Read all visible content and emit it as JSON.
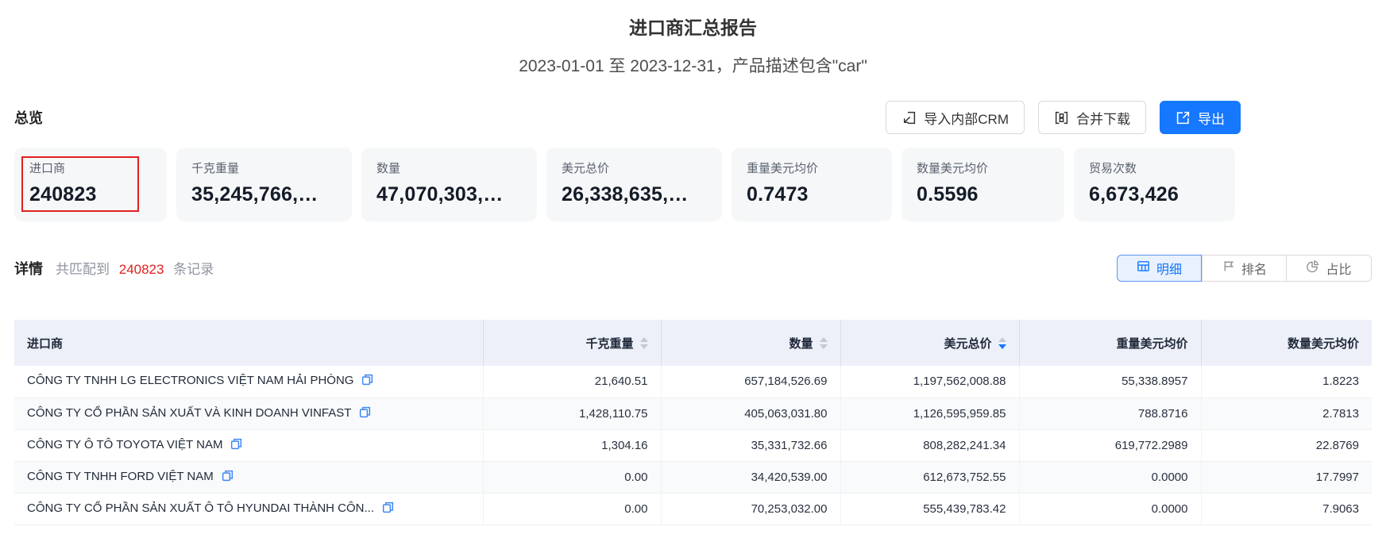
{
  "report": {
    "title": "进口商汇总报告",
    "subtitle": "2023-01-01 至 2023-12-31，产品描述包含\"car\""
  },
  "overview": {
    "section_title": "总览",
    "buttons": [
      {
        "label": "导入内部CRM",
        "icon": "import-icon"
      },
      {
        "label": "合并下载",
        "icon": "merge-download-icon"
      },
      {
        "label": "导出",
        "icon": "export-icon",
        "primary": true
      }
    ],
    "cards": [
      {
        "id": "importers",
        "label": "进口商",
        "value": "240823",
        "highlighted": true
      },
      {
        "id": "kg-weight",
        "label": "千克重量",
        "value": "35,245,766,…"
      },
      {
        "id": "quantity",
        "label": "数量",
        "value": "47,070,303,…"
      },
      {
        "id": "usd-total",
        "label": "美元总价",
        "value": "26,338,635,…"
      },
      {
        "id": "usd-per-kg",
        "label": "重量美元均价",
        "value": "0.7473"
      },
      {
        "id": "usd-per-qty",
        "label": "数量美元均价",
        "value": "0.5596"
      },
      {
        "id": "trade-count",
        "label": "贸易次数",
        "value": "6,673,426"
      }
    ]
  },
  "details": {
    "section_title": "详情",
    "match_prefix": "共匹配到",
    "match_count": "240823",
    "match_suffix": "条记录",
    "tabs": [
      {
        "id": "detail",
        "label": "明细",
        "icon": "table-icon",
        "active": true
      },
      {
        "id": "ranking",
        "label": "排名",
        "icon": "ranking-icon",
        "active": false
      },
      {
        "id": "proportion",
        "label": "占比",
        "icon": "pie-icon",
        "active": false
      }
    ]
  },
  "table": {
    "row_icon": "copy-icon",
    "columns": [
      {
        "key": "name",
        "label": "进口商",
        "align": "left",
        "sortable": false,
        "sort": null
      },
      {
        "key": "kg",
        "label": "千克重量",
        "align": "right",
        "sortable": true,
        "sort": null
      },
      {
        "key": "qty",
        "label": "数量",
        "align": "right",
        "sortable": true,
        "sort": null
      },
      {
        "key": "usd",
        "label": "美元总价",
        "align": "right",
        "sortable": true,
        "sort": "desc"
      },
      {
        "key": "kg_avg",
        "label": "重量美元均价",
        "align": "right",
        "sortable": false,
        "sort": null
      },
      {
        "key": "qty_avg",
        "label": "数量美元均价",
        "align": "right",
        "sortable": false,
        "sort": null
      }
    ],
    "rows": [
      {
        "name": "CÔNG TY TNHH LG ELECTRONICS VIỆT NAM HẢI PHÒNG",
        "kg": "21,640.51",
        "qty": "657,184,526.69",
        "usd": "1,197,562,008.88",
        "kg_avg": "55,338.8957",
        "qty_avg": "1.8223"
      },
      {
        "name": "CÔNG TY CỔ PHẦN SẢN XUẤT VÀ KINH DOANH VINFAST",
        "kg": "1,428,110.75",
        "qty": "405,063,031.80",
        "usd": "1,126,595,959.85",
        "kg_avg": "788.8716",
        "qty_avg": "2.7813"
      },
      {
        "name": "CÔNG TY Ô TÔ TOYOTA VIỆT NAM",
        "kg": "1,304.16",
        "qty": "35,331,732.66",
        "usd": "808,282,241.34",
        "kg_avg": "619,772.2989",
        "qty_avg": "22.8769"
      },
      {
        "name": "CÔNG TY TNHH FORD VIỆT NAM",
        "kg": "0.00",
        "qty": "34,420,539.00",
        "usd": "612,673,752.55",
        "kg_avg": "0.0000",
        "qty_avg": "17.7997"
      },
      {
        "name": "CÔNG TY CỔ PHẦN SẢN XUẤT Ô TÔ HYUNDAI THÀNH CÔN...",
        "kg": "0.00",
        "qty": "70,253,032.00",
        "usd": "555,439,783.42",
        "kg_avg": "0.0000",
        "qty_avg": "7.9063"
      }
    ]
  },
  "colors": {
    "accent": "#1677ff",
    "highlight_red": "#e02020",
    "table_header_bg": "#edf0f9",
    "card_bg": "#f6f7f8",
    "active_tab_bg": "#e8f1fd"
  }
}
